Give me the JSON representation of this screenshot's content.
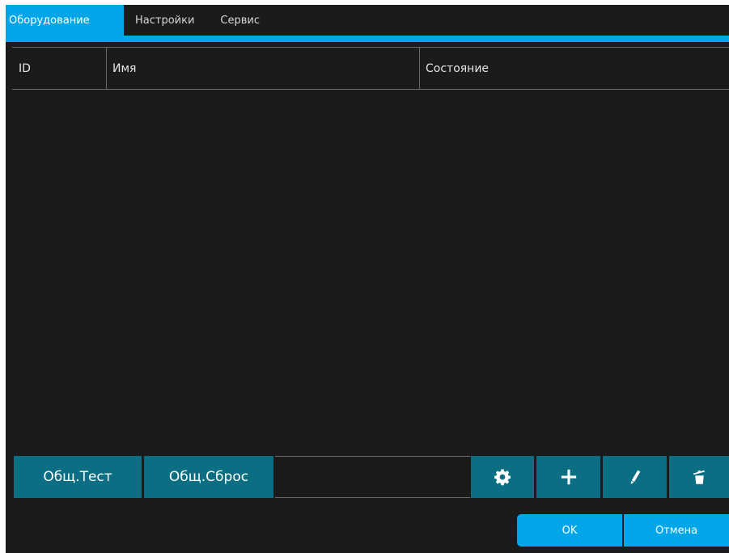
{
  "tabs": [
    {
      "label": "Оборудование",
      "active": true
    },
    {
      "label": "Настройки",
      "active": false
    },
    {
      "label": "Сервис",
      "active": false
    }
  ],
  "grid": {
    "columns": [
      "ID",
      "Имя",
      "Состояние"
    ],
    "rows": []
  },
  "toolbar": {
    "test_label": "Общ.Тест",
    "reset_label": "Общ.Сброс",
    "icons": [
      "gear-icon",
      "plus-icon",
      "pencil-icon",
      "trash-icon"
    ]
  },
  "footer": {
    "ok_label": "OK",
    "cancel_label": "Отмена"
  },
  "colors": {
    "background": "#1b1b1b",
    "accent": "#00a6e8",
    "button": "#0b6e82",
    "text": "#e6e6e6"
  }
}
